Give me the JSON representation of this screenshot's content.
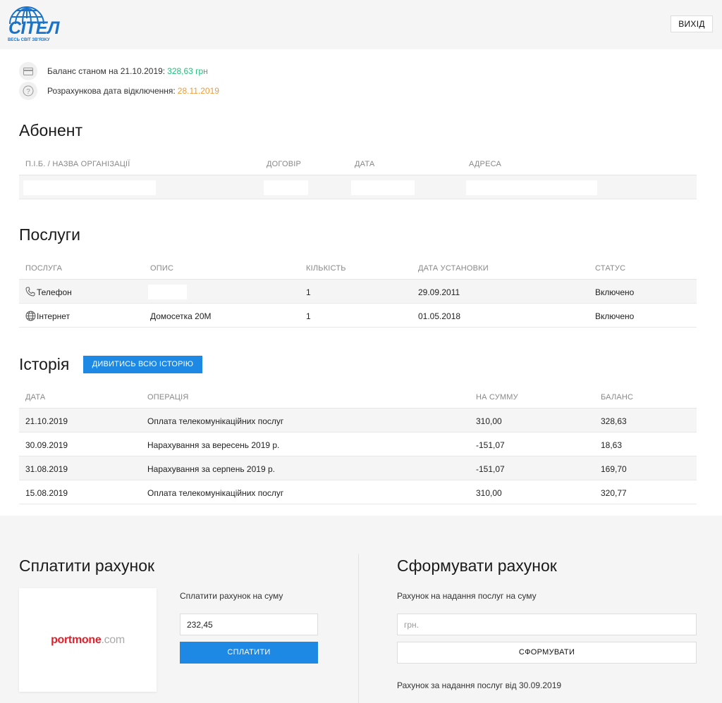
{
  "header": {
    "logo_text": "СІТЕЛ",
    "logo_slogan": "ВЕСЬ СВІТ ЗВ'ЯЗКУ",
    "exit_label": "ВИХІД"
  },
  "info": {
    "balance_label": "Баланс станом на 21.10.2019: ",
    "balance_value": "328,63 грн",
    "disconnect_label": "Розрахункова дата відключення: ",
    "disconnect_value": "28.11.2019"
  },
  "subscriber": {
    "title": "Абонент",
    "columns": [
      "П.І.Б. / НАЗВА ОРГАНІЗАЦІЇ",
      "ДОГОВІР",
      "ДАТА",
      "АДРЕСА"
    ]
  },
  "services": {
    "title": "Послуги",
    "columns": [
      "ПОСЛУГА",
      "ОПИС",
      "КІЛЬКІСТЬ",
      "ДАТА УСТАНОВКИ",
      "СТАТУС"
    ],
    "rows": [
      {
        "name": "Телефон",
        "icon": "phone-icon",
        "desc": "",
        "qty": "1",
        "date": "29.09.2011",
        "status": "Включено"
      },
      {
        "name": "Інтернет",
        "icon": "globe-icon",
        "desc": "Домосетка 20М",
        "qty": "1",
        "date": "01.05.2018",
        "status": "Включено"
      }
    ]
  },
  "history": {
    "title": "Історія",
    "view_all_label": "ДИВИТИСЬ ВСЮ ІСТОРІЮ",
    "columns": [
      "ДАТА",
      "ОПЕРАЦІЯ",
      "НА СУММУ",
      "БАЛАНС"
    ],
    "rows": [
      {
        "date": "21.10.2019",
        "op": "Оплата телекомунікаційних послуг",
        "sum": "310,00",
        "sign": "pos",
        "balance": "328,63"
      },
      {
        "date": "30.09.2019",
        "op": "Нарахування за вересень 2019 р.",
        "sum": "-151,07",
        "sign": "neg",
        "balance": "18,63"
      },
      {
        "date": "31.08.2019",
        "op": "Нарахування за серпень 2019 р.",
        "sum": "-151,07",
        "sign": "neg",
        "balance": "169,70"
      },
      {
        "date": "15.08.2019",
        "op": "Оплата телекомунікаційних послуг",
        "sum": "310,00",
        "sign": "pos",
        "balance": "320,77"
      }
    ]
  },
  "pay": {
    "title": "Сплатити рахунок",
    "logo_word": "portmone",
    "logo_suffix": ".com",
    "amount_label": "Сплатити рахунок на суму",
    "amount_value": "232,45",
    "pay_label": "СПЛАТИТИ"
  },
  "invoice": {
    "title": "Сформувати рахунок",
    "amount_label": "Рахунок на надання послуг на суму",
    "amount_placeholder": "грн.",
    "form_label": "СФОРМУВАТИ",
    "last_invoice": "Рахунок за надання послуг від 30.09.2019"
  },
  "colors": {
    "accent": "#1e88e5",
    "positive": "#1fbf7a",
    "negative": "#e8334a",
    "warning": "#f29a33"
  }
}
